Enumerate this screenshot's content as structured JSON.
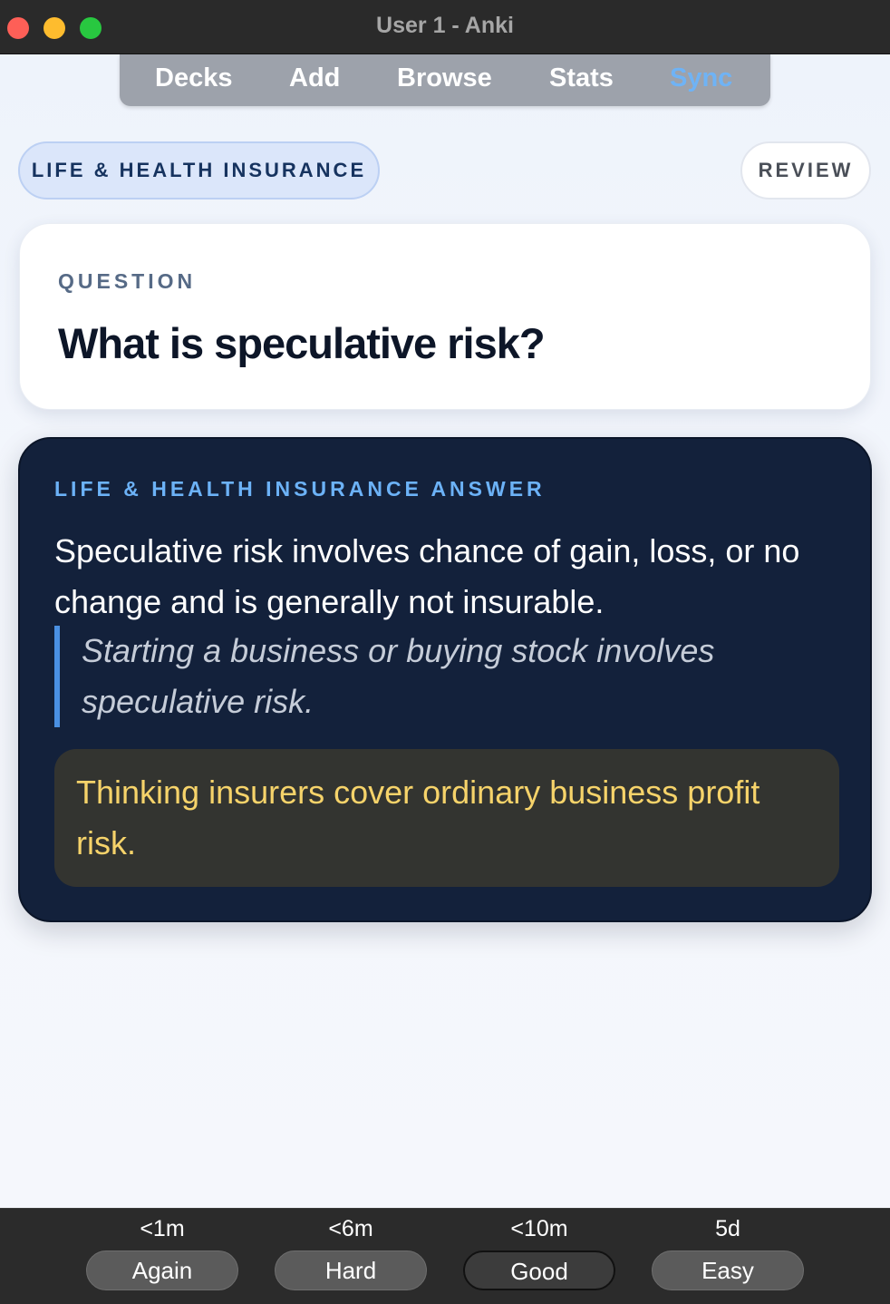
{
  "window": {
    "title": "User 1 - Anki"
  },
  "menu": {
    "decks": "Decks",
    "add": "Add",
    "browse": "Browse",
    "stats": "Stats",
    "sync": "Sync"
  },
  "deck_pill": "LIFE & HEALTH INSURANCE",
  "review_pill": "REVIEW",
  "question": {
    "label": "QUESTION",
    "text": "What is speculative risk?"
  },
  "answer": {
    "label": "LIFE & HEALTH INSURANCE ANSWER",
    "text": "Speculative risk involves chance of gain, loss, or no change and is generally not insurable.",
    "example": "Starting a business or buying stock involves speculative risk.",
    "pitfall": "Thinking insurers cover ordinary business profit risk."
  },
  "buttons": [
    {
      "time": "<1m",
      "label": "Again"
    },
    {
      "time": "<6m",
      "label": "Hard"
    },
    {
      "time": "<10m",
      "label": "Good"
    },
    {
      "time": "5d",
      "label": "Easy"
    }
  ],
  "colors": {
    "accent": "#6cb2f7",
    "answer_bg": "#13213b",
    "pitfall_text": "#f6d36a"
  }
}
